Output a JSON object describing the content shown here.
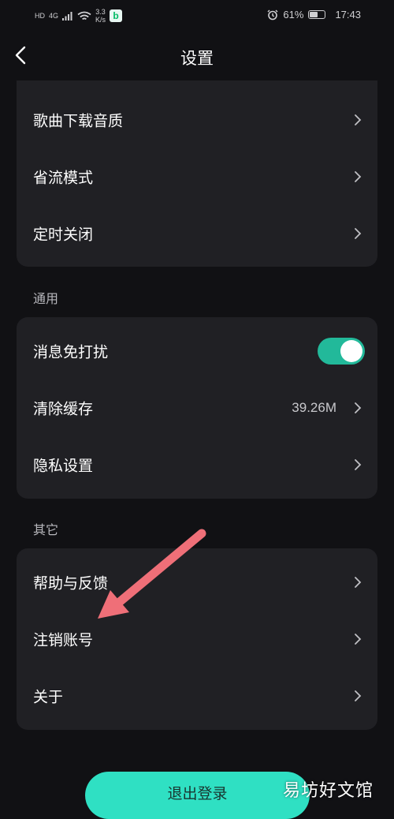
{
  "status_bar": {
    "network_hd": "HD",
    "network_gen": "4G",
    "speed_value": "3.3",
    "speed_unit": "K/s",
    "app_icon_letter": "b",
    "battery_percent": "61%",
    "battery_level": 0.61,
    "time": "17:43"
  },
  "header": {
    "title": "设置"
  },
  "card1": {
    "items": [
      {
        "label": "歌曲下载音质"
      },
      {
        "label": "省流模式"
      },
      {
        "label": "定时关闭"
      }
    ]
  },
  "section_general": {
    "title": "通用",
    "items": [
      {
        "label": "消息免打扰",
        "toggle_on": true
      },
      {
        "label": "清除缓存",
        "value": "39.26M"
      },
      {
        "label": "隐私设置"
      }
    ]
  },
  "section_other": {
    "title": "其它",
    "items": [
      {
        "label": "帮助与反馈"
      },
      {
        "label": "注销账号"
      },
      {
        "label": "关于"
      }
    ]
  },
  "logout_label": "退出登录",
  "watermark": "易坊好文馆",
  "colors": {
    "background": "#111114",
    "card": "#202024",
    "accent": "#22b99a",
    "logout_button": "#2fe0c3",
    "annotation_arrow": "#ef6f78"
  }
}
